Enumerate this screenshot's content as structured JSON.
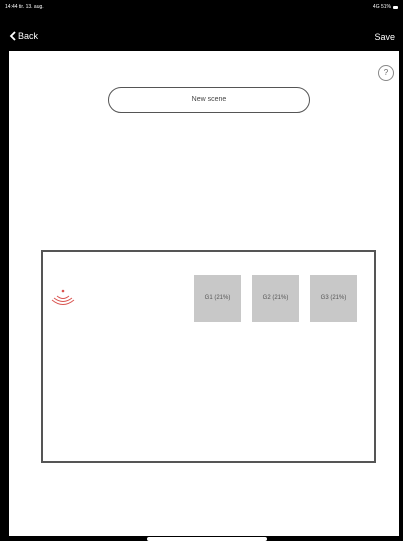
{
  "status_bar": {
    "time_date": "14:44  tir. 13. aug.",
    "signal": "4G 51%"
  },
  "nav": {
    "back_label": "Back",
    "save_label": "Save"
  },
  "help": {
    "label": "?"
  },
  "scene": {
    "name": "New scene"
  },
  "groups": [
    {
      "label": "G1 (21%)"
    },
    {
      "label": "G2 (21%)"
    },
    {
      "label": "G3 (21%)"
    }
  ],
  "colors": {
    "sensor": "#d9534f",
    "tile": "#c8c8c8"
  },
  "icons": {
    "back": "chevron-left-icon",
    "sensor": "motion-sensor-icon",
    "help": "help-icon"
  }
}
